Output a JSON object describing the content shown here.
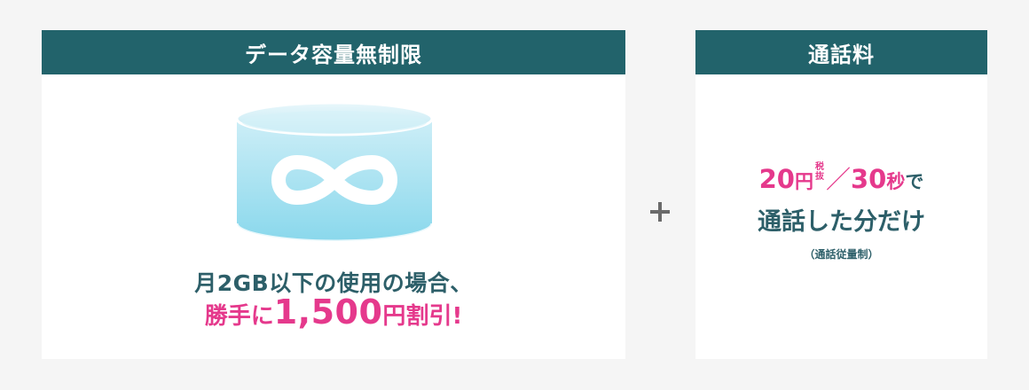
{
  "data_card": {
    "header": "データ容量無制限",
    "icon": "infinity-cylinder-icon",
    "line1": "月2GB以下の使用の場合、",
    "line2": {
      "prefix": "勝手に",
      "amount": "1,500",
      "unit": "円",
      "suffix": "割引!"
    }
  },
  "plus_symbol": "plus-icon",
  "call_card": {
    "header": "通話料",
    "price": {
      "amount1": "20",
      "unit": "円",
      "tax_top": "税",
      "tax_bottom": "抜",
      "slash": "／",
      "amount2": "30",
      "time_unit": "秒",
      "particle": "で"
    },
    "line2": "通話した分だけ",
    "note": "（通話従量制）"
  },
  "colors": {
    "header_bg": "#22636b",
    "accent_pink": "#e5398c",
    "text_teal": "#2d5f69",
    "page_bg": "#f5f5f5"
  }
}
